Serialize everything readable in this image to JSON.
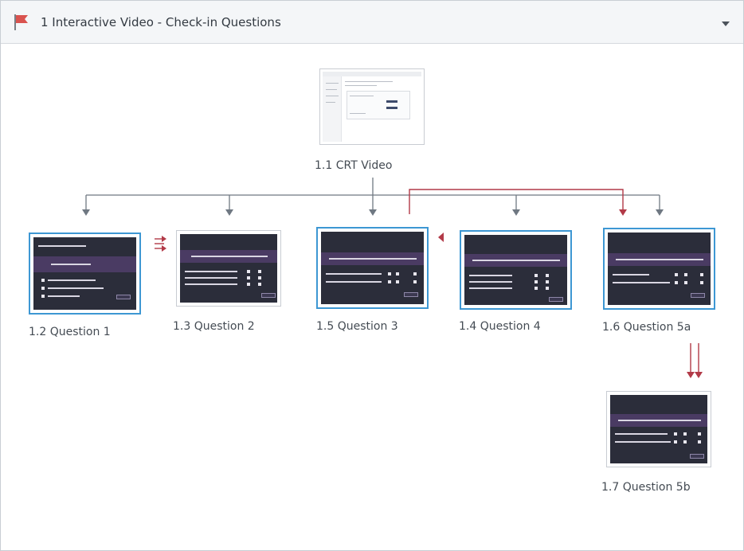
{
  "header": {
    "title": "1 Interactive Video - Check-in Questions",
    "flag_icon": "flag-icon",
    "dropdown_icon": "dropdown-arrow-icon",
    "flag_color": "#d9534f"
  },
  "slides": {
    "s11": {
      "label": "1.1 CRT Video"
    },
    "s12": {
      "label": "1.2 Question 1"
    },
    "s13": {
      "label": "1.3 Question 2"
    },
    "s15": {
      "label": "1.5 Question 3"
    },
    "s14": {
      "label": "1.4 Question 4"
    },
    "s16": {
      "label": "1.6 Question 5a"
    },
    "s17": {
      "label": "1.7 Question 5b"
    }
  },
  "colors": {
    "selection": "#3d97d3",
    "connector_gray": "#6f7882",
    "connector_red": "#b23a48"
  }
}
